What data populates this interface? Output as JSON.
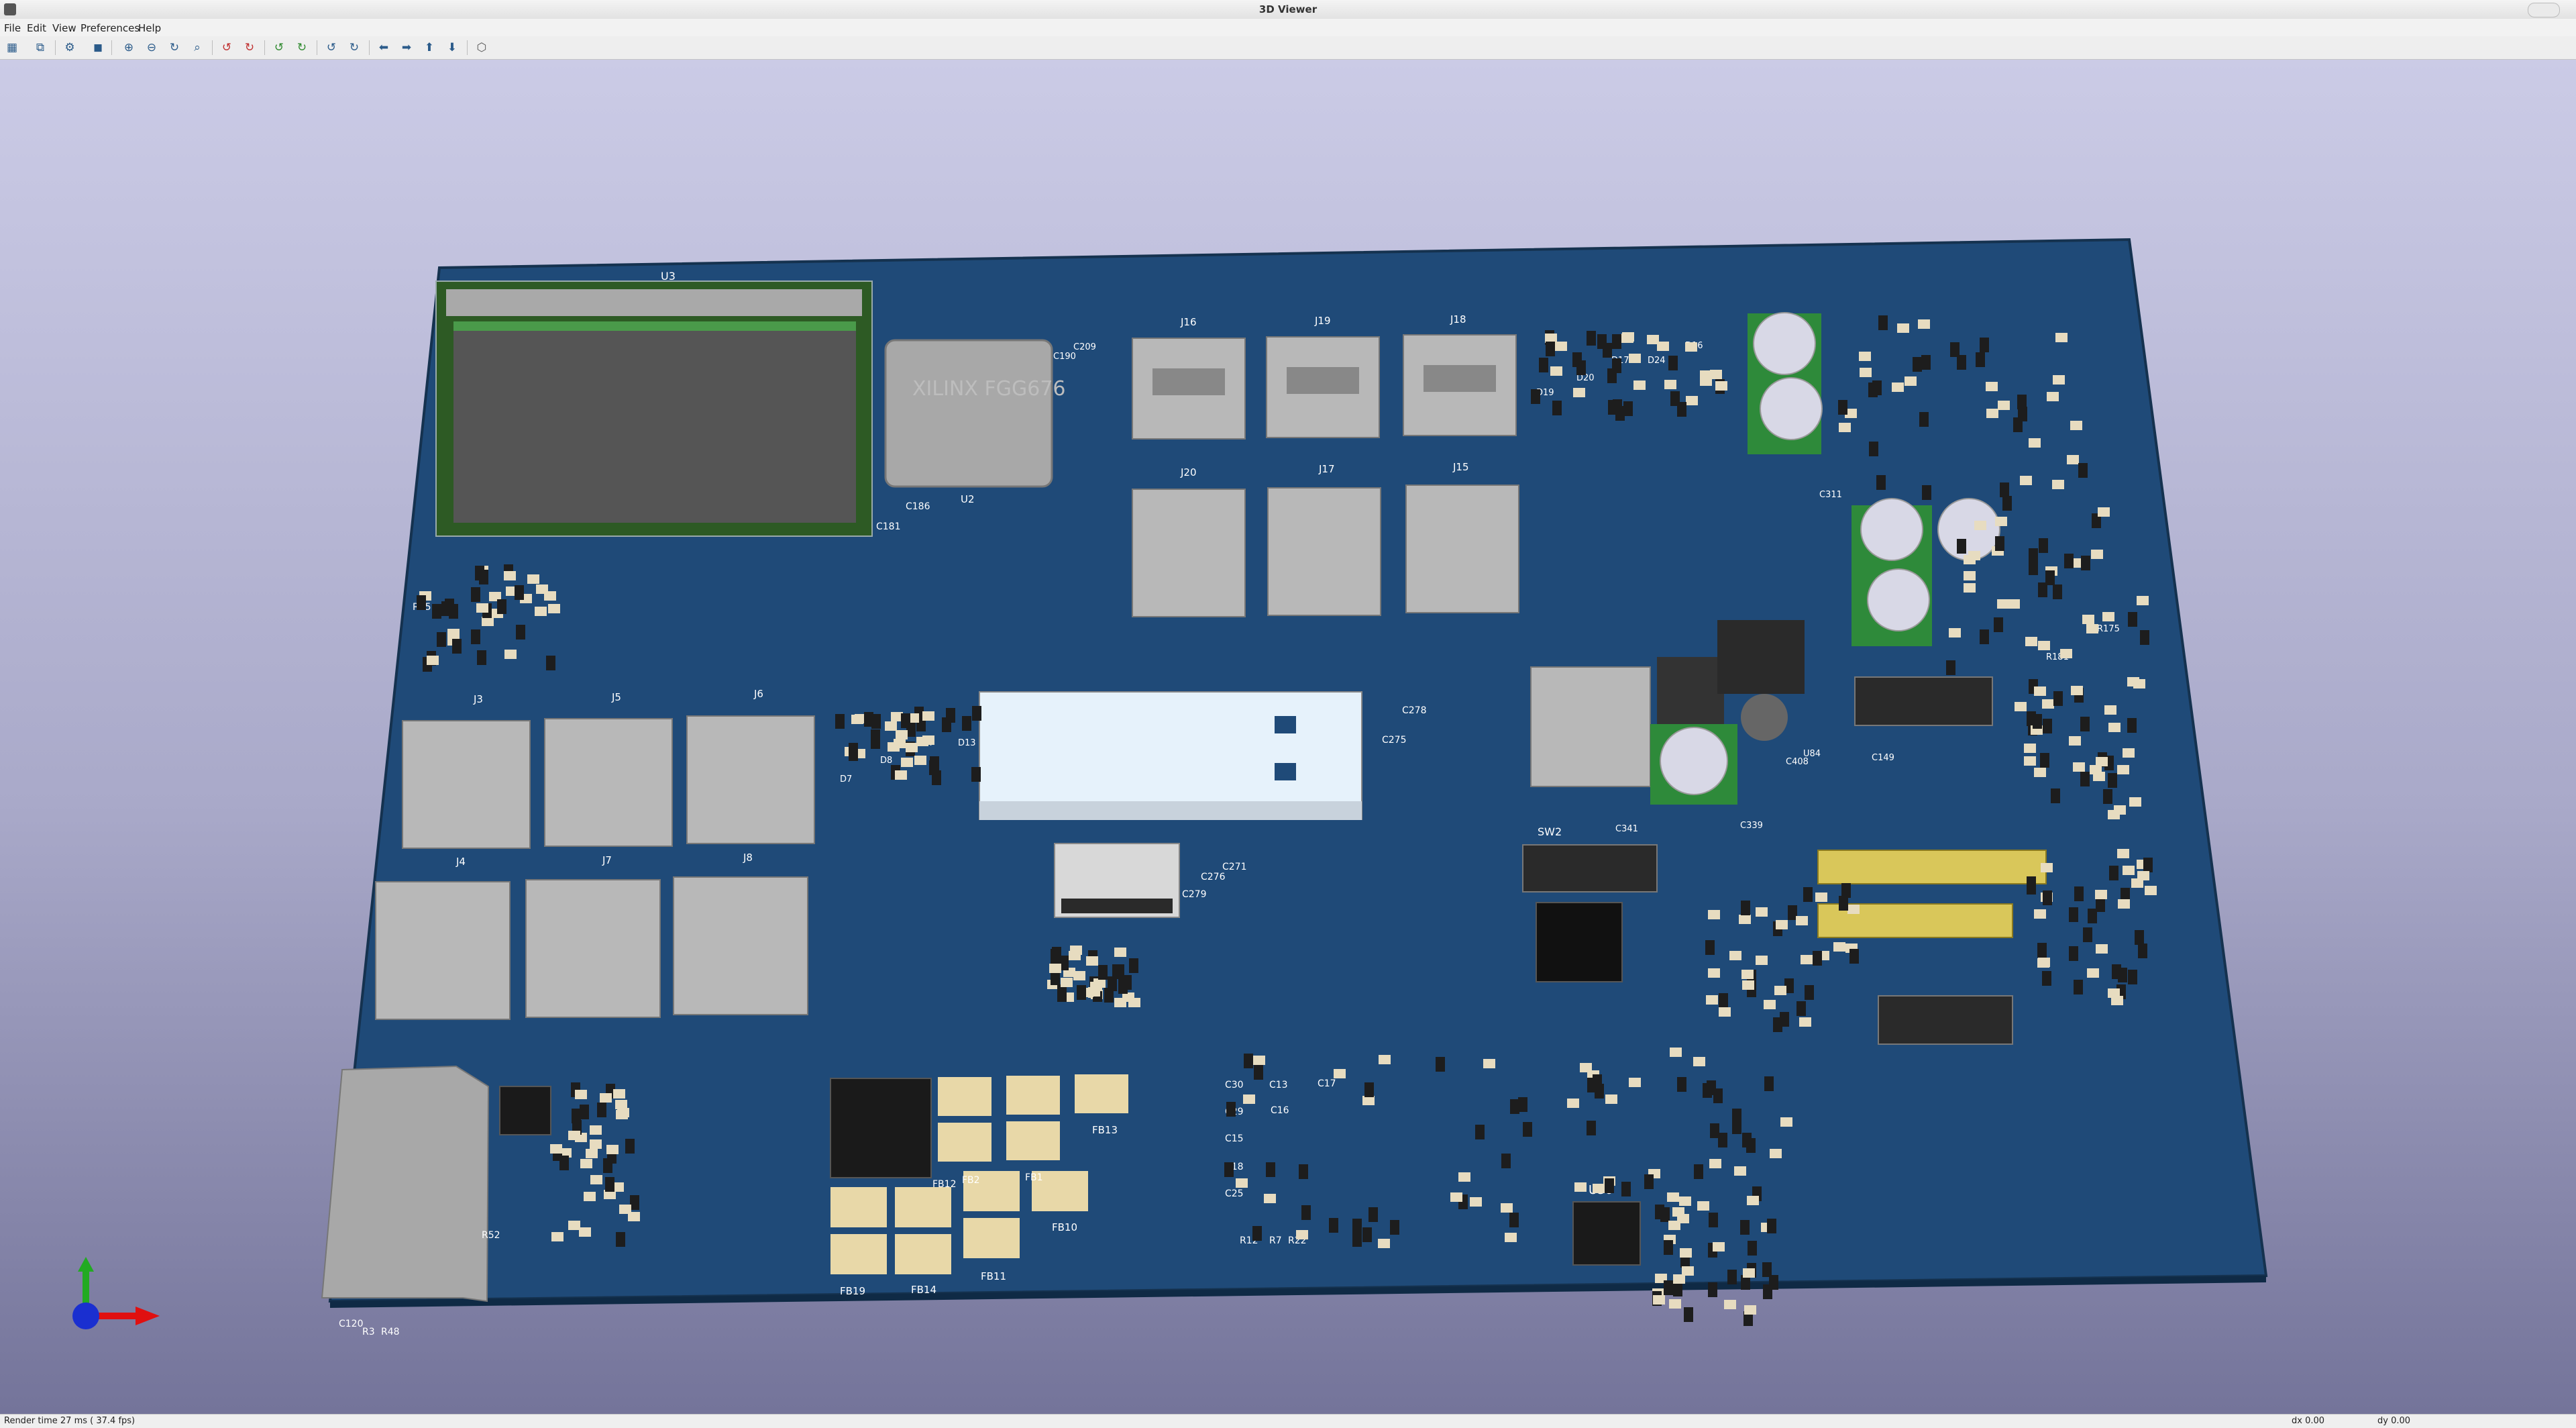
{
  "window": {
    "title": "3D Viewer"
  },
  "menu": {
    "items": [
      "File",
      "Edit",
      "View",
      "Preferences",
      "Help"
    ]
  },
  "toolbar": {
    "icons": [
      "reload-board-icon",
      "copy-image-icon",
      "render-options-icon",
      "render-quality-icon",
      "zoom-in-icon",
      "zoom-out-icon",
      "zoom-redraw-icon",
      "zoom-fit-icon",
      "rotate-x-ccw-icon",
      "rotate-x-cw-icon",
      "rotate-y-ccw-icon",
      "rotate-y-cw-icon",
      "rotate-z-ccw-icon",
      "rotate-z-cw-icon",
      "pan-left-icon",
      "pan-right-icon",
      "pan-up-icon",
      "pan-down-icon",
      "toggle-orthographic-icon"
    ]
  },
  "board": {
    "colors": {
      "soldermask": "#1f4a78",
      "silkscreen": "#ffffff",
      "edge": "#15324f",
      "connector": "#b4b4b4",
      "gold": "#d9c75a",
      "capacitor": "#d8d8e6"
    },
    "labels": {
      "U3": "U3",
      "U2": "U2",
      "fpga_text": "XILINX FGG676",
      "J16": "J16",
      "J19": "J19",
      "J18": "J18",
      "J20": "J20",
      "J17": "J17",
      "J15": "J15",
      "J3": "J3",
      "J5": "J5",
      "J6": "J6",
      "J4": "J4",
      "J7": "J7",
      "J8": "J8",
      "SW2": "SW2",
      "U36": "U36",
      "FB13": "FB13",
      "FB10": "FB10",
      "FB11": "FB11",
      "FB14": "FB14",
      "FB19": "FB19",
      "FB12": "FB12",
      "FB2": "FB2",
      "FB1": "FB1",
      "C278": "C278",
      "C275": "C275",
      "C276": "C276",
      "C271": "C271",
      "C279": "C279",
      "C186": "C186",
      "C181": "C181",
      "C190": "C190",
      "C209": "C209",
      "C30": "C30",
      "C13": "C13",
      "C17": "C17",
      "C29": "C29",
      "C16": "C16",
      "C15": "C15",
      "C18": "C18",
      "C25": "C25",
      "R12": "R12",
      "R7": "R7",
      "R22": "R22",
      "C339": "C339",
      "C341": "C341",
      "C408": "C408",
      "C149": "C149",
      "R65": "R65",
      "R52": "R52",
      "R3": "R3",
      "R48": "R48",
      "C120": "C120",
      "D7": "D7",
      "D8": "D8",
      "D4": "D4",
      "D13": "D13",
      "D16": "D16",
      "D17": "D17",
      "D24": "D24",
      "D19": "D19",
      "D20": "D20",
      "U84": "U84",
      "R175": "R175",
      "R181": "R181",
      "C311": "C311"
    }
  },
  "status": {
    "render": "Render time 27 ms ( 37.4 fps)",
    "dx": "dx 0.00",
    "dy": "dy 0.00"
  }
}
